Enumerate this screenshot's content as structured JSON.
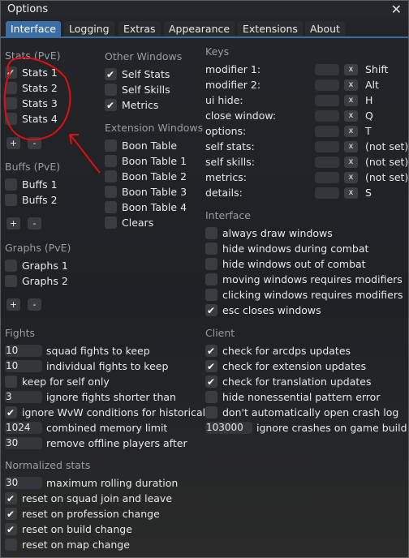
{
  "window": {
    "title": "Options",
    "close_glyph": "✕"
  },
  "tabs": [
    "Interface",
    "Logging",
    "Extras",
    "Appearance",
    "Extensions",
    "About"
  ],
  "stats": {
    "header": "Stats (PvE)",
    "items": [
      {
        "label": "Stats 1",
        "checked": true
      },
      {
        "label": "Stats 2",
        "checked": false
      },
      {
        "label": "Stats 3",
        "checked": false
      },
      {
        "label": "Stats 4",
        "checked": false
      }
    ]
  },
  "other_windows": {
    "header": "Other Windows",
    "items": [
      {
        "label": "Self Stats",
        "checked": true
      },
      {
        "label": "Self Skills",
        "checked": false
      },
      {
        "label": "Metrics",
        "checked": true
      }
    ]
  },
  "extension_windows": {
    "header": "Extension Windows",
    "items": [
      {
        "label": "Boon Table",
        "checked": false
      },
      {
        "label": "Boon Table 1",
        "checked": false
      },
      {
        "label": "Boon Table 2",
        "checked": false
      },
      {
        "label": "Boon Table 3",
        "checked": false
      },
      {
        "label": "Boon Table 4",
        "checked": false
      },
      {
        "label": "Clears",
        "checked": false
      }
    ]
  },
  "buffs": {
    "header": "Buffs (PvE)",
    "items": [
      {
        "label": "Buffs 1",
        "checked": false
      },
      {
        "label": "Buffs 2",
        "checked": false
      }
    ]
  },
  "graphs": {
    "header": "Graphs (PvE)",
    "items": [
      {
        "label": "Graphs 1",
        "checked": false
      },
      {
        "label": "Graphs 2",
        "checked": false
      }
    ]
  },
  "add_label": "+",
  "remove_label": "-",
  "keys": {
    "header": "Keys",
    "clear_label": "x",
    "items": [
      {
        "label": "modifier 1:",
        "value": "Shift"
      },
      {
        "label": "modifier 2:",
        "value": "Alt"
      },
      {
        "label": "ui hide:",
        "value": "H"
      },
      {
        "label": "close window:",
        "value": "Q"
      },
      {
        "label": "options:",
        "value": "T"
      },
      {
        "label": "self stats:",
        "value": "(not set)"
      },
      {
        "label": "self skills:",
        "value": "(not set)"
      },
      {
        "label": "metrics:",
        "value": "(not set)"
      },
      {
        "label": "details:",
        "value": "S"
      }
    ]
  },
  "interface": {
    "header": "Interface",
    "items": [
      {
        "label": "always draw windows",
        "checked": false
      },
      {
        "label": "hide windows during combat",
        "checked": false
      },
      {
        "label": "hide windows out of combat",
        "checked": false
      },
      {
        "label": "moving windows requires modifiers",
        "checked": false
      },
      {
        "label": "clicking windows requires modifiers",
        "checked": false
      },
      {
        "label": "esc closes windows",
        "checked": true
      }
    ]
  },
  "fights": {
    "header": "Fights",
    "items": [
      {
        "kind": "num",
        "value": "10",
        "label": "squad fights to keep"
      },
      {
        "kind": "num",
        "value": "10",
        "label": "individual fights to keep"
      },
      {
        "kind": "check",
        "checked": false,
        "label": "keep for self only"
      },
      {
        "kind": "num",
        "value": "3",
        "label": "ignore fights shorter than"
      },
      {
        "kind": "check",
        "checked": true,
        "label": "ignore WvW conditions for historical"
      },
      {
        "kind": "num",
        "value": "1024",
        "label": "combined memory limit"
      },
      {
        "kind": "num",
        "value": "30",
        "label": "remove offline players after"
      }
    ]
  },
  "client": {
    "header": "Client",
    "items": [
      {
        "kind": "check",
        "checked": true,
        "label": "check for arcdps updates"
      },
      {
        "kind": "check",
        "checked": true,
        "label": "check for extension updates"
      },
      {
        "kind": "check",
        "checked": true,
        "label": "check for translation updates"
      },
      {
        "kind": "check",
        "checked": false,
        "label": "hide nonessential pattern error"
      },
      {
        "kind": "check",
        "checked": false,
        "label": "don't automatically open crash log"
      },
      {
        "kind": "num",
        "value": "103000",
        "label": "ignore crashes on game build"
      }
    ]
  },
  "normalized": {
    "header": "Normalized stats",
    "items": [
      {
        "kind": "num",
        "value": "30",
        "label": "maximum rolling duration"
      },
      {
        "kind": "check",
        "checked": true,
        "label": "reset on squad join and leave"
      },
      {
        "kind": "check",
        "checked": true,
        "label": "reset on profession change"
      },
      {
        "kind": "check",
        "checked": true,
        "label": "reset on build change"
      },
      {
        "kind": "check",
        "checked": false,
        "label": "reset on map change"
      }
    ]
  },
  "colors": {
    "accent": "#3a6ea5",
    "annotation": "#e01010"
  }
}
